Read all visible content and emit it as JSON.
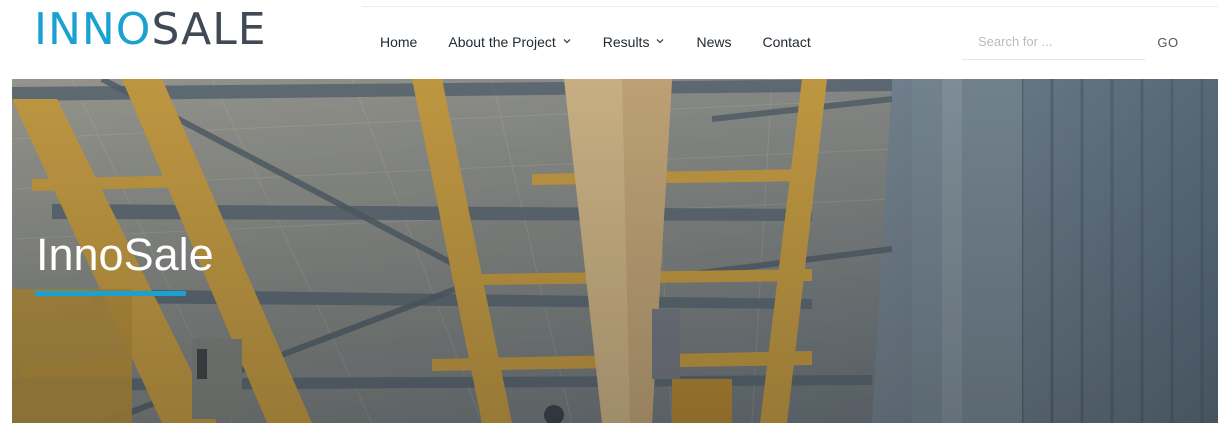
{
  "logo": {
    "part_a": "INNO",
    "part_b": "SALE"
  },
  "nav": {
    "items": [
      {
        "label": "Home",
        "has_dropdown": false
      },
      {
        "label": "About the Project",
        "has_dropdown": true
      },
      {
        "label": "Results",
        "has_dropdown": true
      },
      {
        "label": "News",
        "has_dropdown": false
      },
      {
        "label": "Contact",
        "has_dropdown": false
      }
    ]
  },
  "search": {
    "placeholder": "Search for ...",
    "value": "",
    "button_label": "GO"
  },
  "hero": {
    "title": "InnoSale",
    "accent_color": "#1aa1cf"
  },
  "colors": {
    "brand_blue": "#1aa1cf",
    "brand_dark": "#3f4a56"
  },
  "icons": {
    "dropdown": "chevron-down-icon"
  }
}
